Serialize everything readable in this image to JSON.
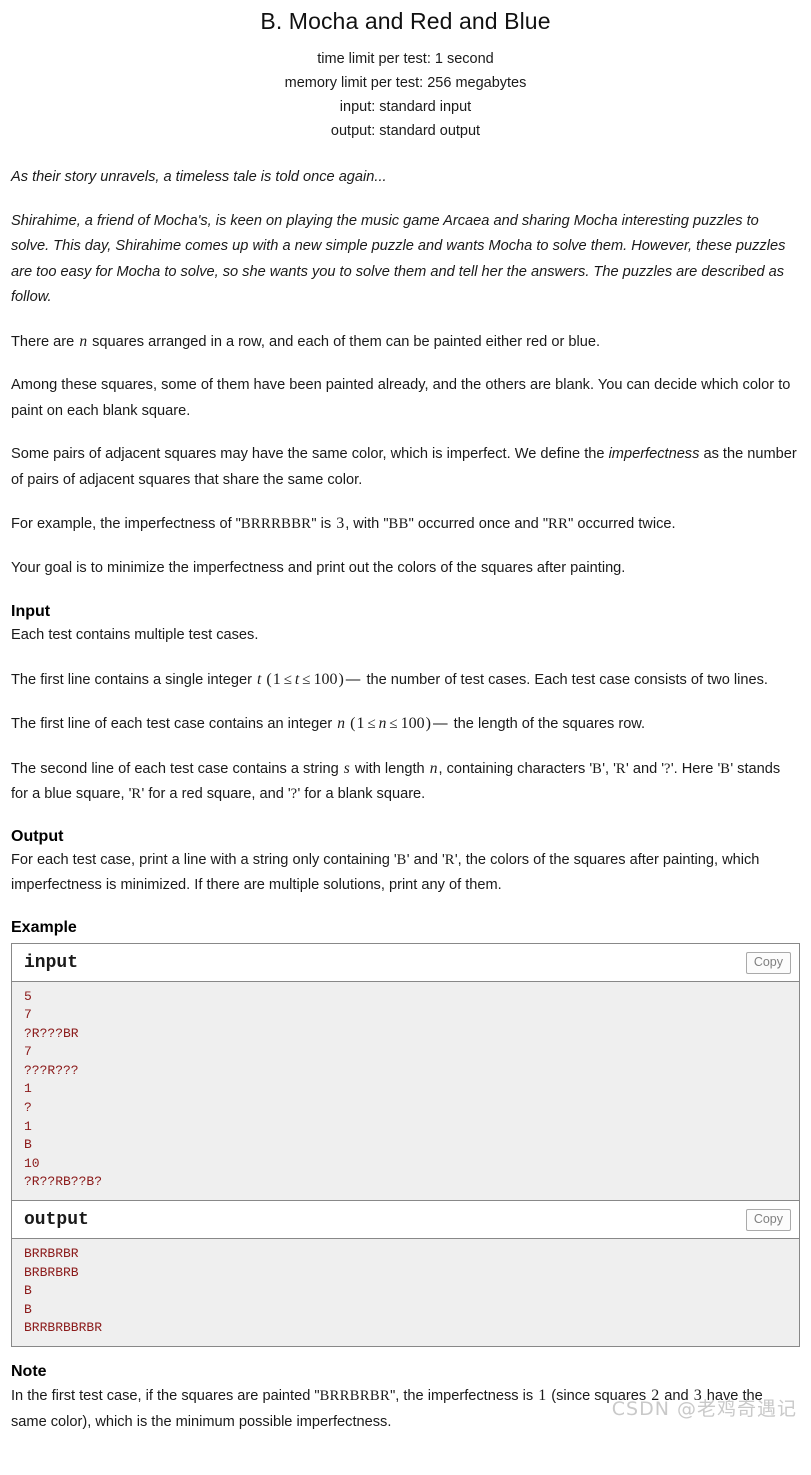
{
  "problem": {
    "title": "B. Mocha and Red and Blue",
    "time_limit": "time limit per test: 1 second",
    "memory_limit": "memory limit per test: 256 megabytes",
    "input_spec": "input: standard input",
    "output_spec": "output: standard output"
  },
  "legend": {
    "flavor_quote": "As their story unravels, a timeless tale is told once again...",
    "story": "Shirahime, a friend of Mocha's, is keen on playing the music game Arcaea and sharing Mocha interesting puzzles to solve. This day, Shirahime comes up with a new simple puzzle and wants Mocha to solve them. However, these puzzles are too easy for Mocha to solve, so she wants you to solve them and tell her the answers. The puzzles are described as follow.",
    "p1_a": "There are ",
    "p1_var": "n",
    "p1_b": " squares arranged in a row, and each of them can be painted either red or blue.",
    "p2": "Among these squares, some of them have been painted already, and the others are blank. You can decide which color to paint on each blank square.",
    "p3_a": "Some pairs of adjacent squares may have the same color, which is imperfect. We define the ",
    "p3_em": "imperfectness",
    "p3_b": " as the number of pairs of adjacent squares that share the same color.",
    "p4_a": "For example, the imperfectness of \"",
    "p4_str": "BRRRBBR",
    "p4_b": "\" is ",
    "p4_num": "3",
    "p4_c": ", with \"",
    "p4_bb": "BB",
    "p4_d": "\" occurred once and \"",
    "p4_rr": "RR",
    "p4_e": "\" occurred twice.",
    "p5": "Your goal is to minimize the imperfectness and print out the colors of the squares after painting."
  },
  "input_section": {
    "heading": "Input",
    "line1": "Each test contains multiple test cases.",
    "p2_a": "The first line contains a single integer ",
    "p2_var": "t",
    "p2_open": "(",
    "p2_lo": "1",
    "p2_rel1": "≤",
    "p2_var2": "t",
    "p2_rel2": "≤",
    "p2_hi": "100",
    "p2_close": ")",
    "p2_dash": "—",
    "p2_b": " the number of test cases. Each test case consists of two lines.",
    "p3_a": "The first line of each test case contains an integer ",
    "p3_var": "n",
    "p3_open": "(",
    "p3_lo": "1",
    "p3_rel1": "≤",
    "p3_var2": "n",
    "p3_rel2": "≤",
    "p3_hi": "100",
    "p3_close": ")",
    "p3_dash": "—",
    "p3_b": " the length of the squares row.",
    "p4_a": "The second line of each test case contains a string ",
    "p4_var_s": "s",
    "p4_b": " with length ",
    "p4_var_n": "n",
    "p4_c": ", containing characters '",
    "p4_B": "B",
    "p4_d": "', '",
    "p4_R": "R",
    "p4_e": "' and '",
    "p4_Q": "?",
    "p4_f": "'. Here '",
    "p4_B2": "B",
    "p4_g": "' stands for a blue square, '",
    "p4_R2": "R",
    "p4_h": "' for a red square, and '",
    "p4_Q2": "?",
    "p4_i": "' for a blank square."
  },
  "output_section": {
    "heading": "Output",
    "p1_a": "For each test case, print a line with a string only containing '",
    "p1_B": "B",
    "p1_b": "' and '",
    "p1_R": "R",
    "p1_c": "', the colors of the squares after painting, which imperfectness is minimized. If there are multiple solutions, print any of them."
  },
  "example": {
    "heading": "Example",
    "input_label": "input",
    "output_label": "output",
    "copy_label": "Copy",
    "input_text": "5\n7\n?R???BR\n7\n???R???\n1\n?\n1\nB\n10\n?R??RB??B?",
    "output_text": "BRRBRBR\nBRBRBRB\nB\nB\nBRRBRBBRBR"
  },
  "note": {
    "heading": "Note",
    "p1_a": "In the first test case, if the squares are painted \"",
    "p1_str": "BRRBRBR",
    "p1_b": "\", the imperfectness is ",
    "p1_num1": "1",
    "p1_c": " (since squares ",
    "p1_num2": "2",
    "p1_d": " and ",
    "p1_num3": "3",
    "p1_e": " have the same color), which is the minimum possible imperfectness."
  },
  "watermark": {
    "text": "CSDN @老鸡奇遇记",
    "color": "#c9c9c9"
  },
  "colors": {
    "sample_text": "#8b1a1a",
    "sample_bg": "#efefef",
    "border": "#888888"
  }
}
